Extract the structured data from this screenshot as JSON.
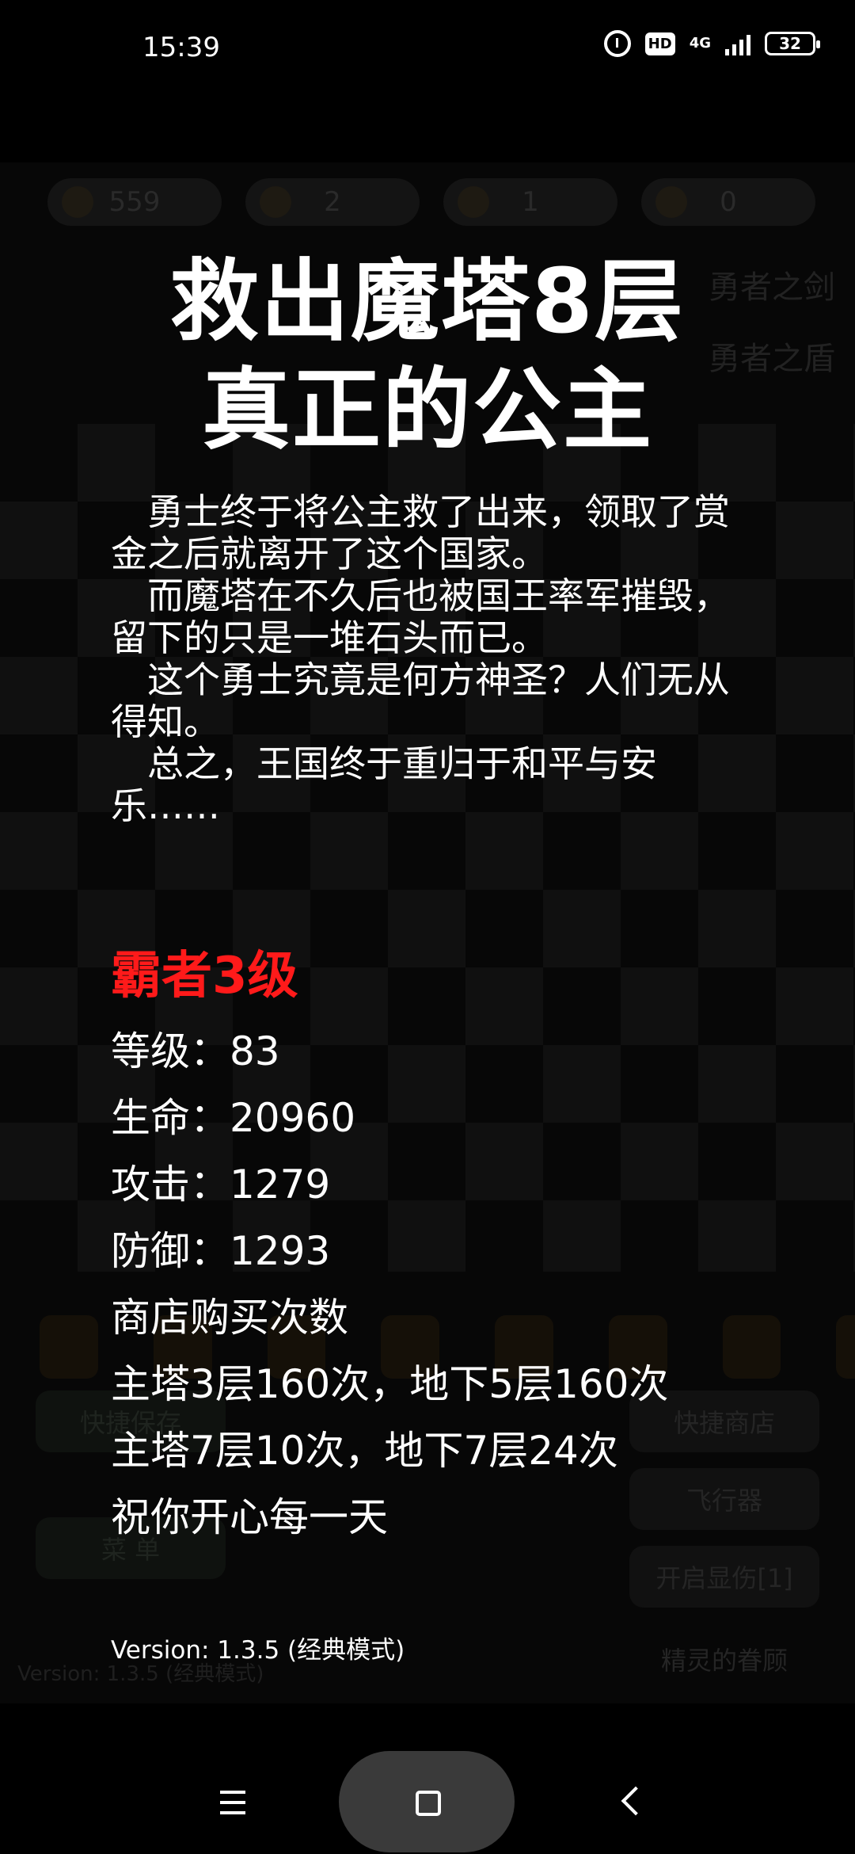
{
  "status_bar": {
    "time": "15:39",
    "hd_label": "HD",
    "network_label": "4G",
    "battery": "32"
  },
  "background": {
    "gold": "559",
    "yellow_keys": "2",
    "blue_keys": "1",
    "red_keys": "0",
    "weapon": "勇者之剑",
    "shield": "勇者之盾",
    "quick_save": "快捷保存",
    "quick_shop": "快捷商店",
    "flyer": "飞行器",
    "damage_display": "开启显伤[1]",
    "spirit_favor": "精灵的眷顾",
    "menu": "菜 单",
    "version": "Version: 1.3.5 (经典模式)"
  },
  "ending": {
    "title_line1": "救出魔塔8层",
    "title_line2": "真正的公主",
    "story": [
      "　勇士终于将公主救了出来，领取了赏金之后就离开了这个国家。",
      "　而魔塔在不久后也被国王率军摧毁，留下的只是一堆石头而已。",
      "　这个勇士究竟是何方神圣？人们无从得知。",
      "　总之，王国终于重归于和平与安乐……"
    ],
    "rank": "霸者3级",
    "level": "等级：83",
    "hp": "生命：20960",
    "attack": "攻击：1279",
    "defense": "防御：1293",
    "shop_title": "商店购买次数",
    "shop_line1": "主塔3层160次，地下5层160次",
    "shop_line2": "主塔7层10次，地下7层24次",
    "wish": "祝你开心每一天",
    "version": "Version: 1.3.5 (经典模式)"
  },
  "colors": {
    "rank": "#ff1a1a",
    "background": "#000000"
  }
}
